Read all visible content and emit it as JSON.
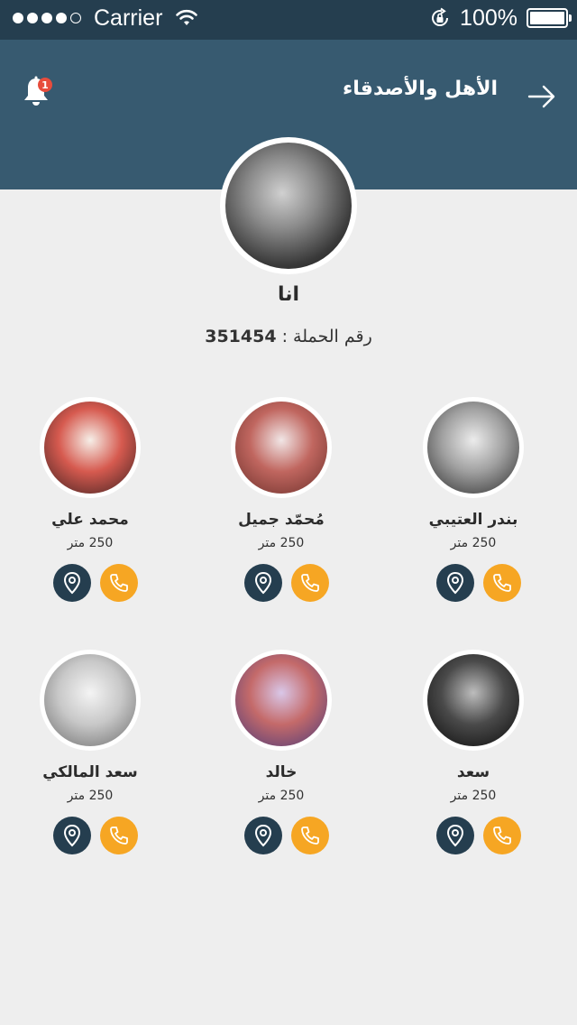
{
  "status_bar": {
    "carrier": "Carrier",
    "battery": "100%",
    "signal_dots_filled": 4,
    "signal_dots_total": 5
  },
  "header": {
    "title": "الأهل والأصدقاء",
    "notification_count": "1",
    "background_color": "#375a70"
  },
  "me": {
    "name": "انا",
    "campaign_label": "رقم الحملة :",
    "campaign_number": "351454"
  },
  "friends": [
    {
      "name": "بندر العتيبي",
      "distance": "250 متر",
      "avatar_colors": [
        "#ececec",
        "#a0a0a0",
        "#2a2a2a"
      ]
    },
    {
      "name": "مُحمّد جميل",
      "distance": "250 متر",
      "avatar_colors": [
        "#f1e6e6",
        "#c0665f",
        "#6a2f2a"
      ]
    },
    {
      "name": "محمد علي",
      "distance": "250 متر",
      "avatar_colors": [
        "#f6efe8",
        "#d65a4f",
        "#3a2020"
      ]
    },
    {
      "name": "سعد",
      "distance": "250 متر",
      "avatar_colors": [
        "#bdbdbd",
        "#4a4a4a",
        "#0a0a0a"
      ]
    },
    {
      "name": "خالد",
      "distance": "250 متر",
      "avatar_colors": [
        "#d9c7e8",
        "#c46a6a",
        "#4a3a7a"
      ]
    },
    {
      "name": "سعد المالكي",
      "distance": "250 متر",
      "avatar_colors": [
        "#f4f4f4",
        "#c8c8c8",
        "#6a6a6a"
      ]
    }
  ],
  "colors": {
    "status_bar": "#253e4f",
    "location_button": "#253e4f",
    "call_button": "#f6a623",
    "badge": "#e74c3c",
    "background": "#eeeeee"
  },
  "icons": {
    "notification": "bell-icon",
    "back": "arrow-right-icon",
    "location": "map-pin-icon",
    "call": "phone-icon",
    "wifi": "wifi-icon",
    "rotation_lock": "rotation-lock-icon"
  }
}
